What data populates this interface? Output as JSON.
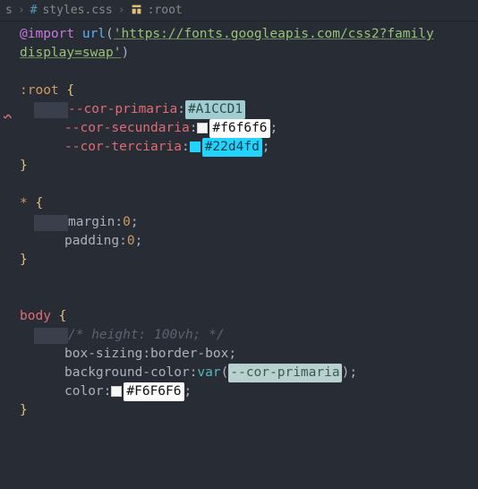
{
  "breadcrumb": {
    "parent": "s",
    "file": "styles.css",
    "symbol": ":root"
  },
  "code": {
    "import_keyword": "@import",
    "import_fn": "url",
    "import_url_line1": "'https://fonts.googleapis.com/css2?family",
    "import_url_line2": "display=swap'",
    "root_selector": ":root",
    "var1_name": "--cor-primaria",
    "var1_value": "#A1CCD1",
    "var2_name": "--cor-secundaria",
    "var2_value": "#f6f6f6",
    "var3_name": "--cor-terciaria",
    "var3_value": "#22d4fd",
    "star_selector": "*",
    "margin_prop": "margin",
    "margin_val": "0",
    "padding_prop": "padding",
    "padding_val": "0",
    "body_selector": "body",
    "comment": "/* height: 100vh; */",
    "boxsizing_prop": "box-sizing",
    "boxsizing_val": "border-box",
    "bg_prop": "background-color",
    "bg_var_fn": "var",
    "bg_var_arg": "--cor-primaria",
    "color_prop": "color",
    "color_val": "#F6F6F6",
    "brace_open": "{",
    "brace_close": "}",
    "paren_open": "(",
    "paren_close": ")",
    "colon": ": ",
    "colon_tight": ":",
    "semi": ";"
  }
}
